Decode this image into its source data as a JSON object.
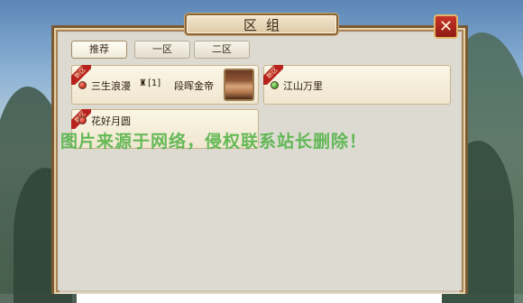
{
  "dialog": {
    "title": "区组",
    "close_glyph": "✕"
  },
  "tabs": [
    {
      "label": "推荐",
      "active": true
    },
    {
      "label": "一区",
      "active": false
    },
    {
      "label": "二区",
      "active": false
    }
  ],
  "servers": [
    {
      "badge": "新区",
      "name": "三生浪漫",
      "role_icon": "♜",
      "role_count": "[1]",
      "character": "段晖金帝",
      "status": "red",
      "has_avatar": true
    },
    {
      "badge": "新区",
      "name": "江山万里",
      "status": "green",
      "has_avatar": false
    },
    {
      "badge": "新区",
      "name": "花好月圆",
      "status": "red",
      "has_avatar": false
    }
  ],
  "watermark": "图片来源于网络，侵权联系站长删除！",
  "colors": {
    "frame": "#7a5a34",
    "badge": "#b7231c",
    "status_red": "#c0281d",
    "status_green": "#3b9c2c",
    "close": "#c93428",
    "watermark": "#46af3c"
  }
}
